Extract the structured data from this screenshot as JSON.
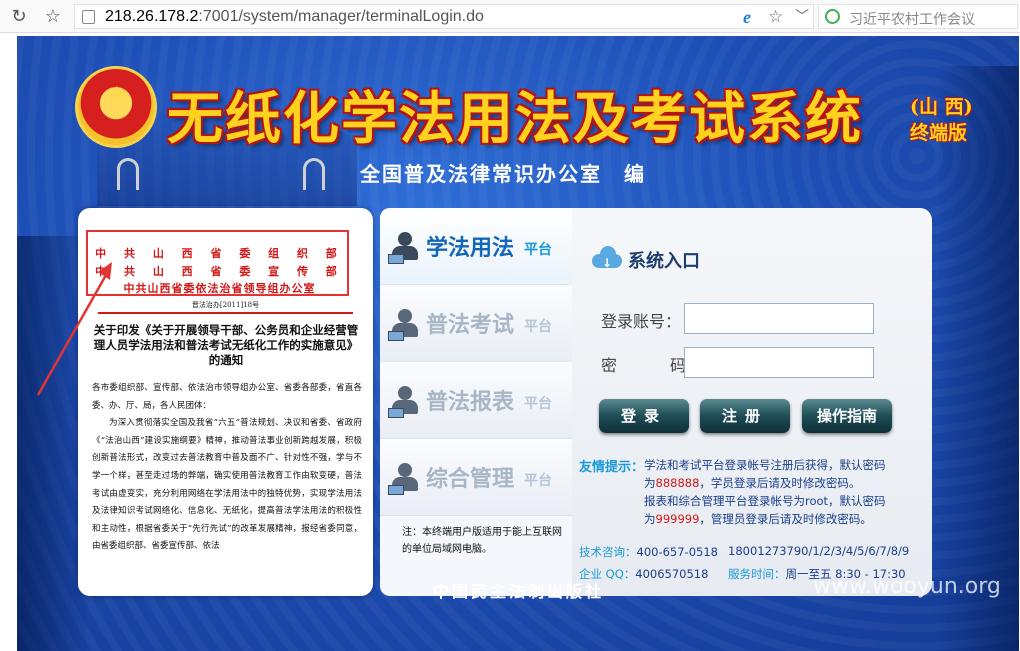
{
  "browser": {
    "url_host": "218.26.178.2",
    "url_rest": ":7001/system/manager/terminalLogin.do",
    "search_placeholder": "习近平农村工作会议"
  },
  "header": {
    "title": "无纸化学法用法及考试系统",
    "region": "(山 西)",
    "version": "终端版",
    "editor": "全国普及法律常识办公室　编"
  },
  "notice": {
    "org_1": "中 共 山 西 省 委 组 织 部",
    "org_2": "中 共 山 西 省 委 宣 传 部",
    "org_3": "中共山西省委依法治省领导组办公室",
    "doc_no": "晋法治办[2011]18号",
    "title": "关于印发《关于开展领导干部、公务员和企业经营管理人员学法用法和普法考试无纸化工作的实施意见》的通知",
    "salutation": "各市委组织部、宣传部、依法治市领导组办公室、省委各部委，省直各委、办、厅、局，各人民团体：",
    "body": "为深入贯彻落实全国及我省“六五”普法规划、决议和省委、省政府《“法治山西”建设实施纲要》精神，推动普法事业创新跨越发展，积极创新普法形式，改变过去普法教育中普及面不广、针对性不强，学与不学一个样，甚至走过场的弊端，确实使用普法教育工作由软变硬，普法考试由虚变实，充分利用网络在学法用法中的独特优势，实现学法用法及法律知识考试网络化、信息化、无纸化，提高普法学法用法的积极性和主动性，根据省委关于“先行先试”的改革发展精神，报经省委同意，由省委组织部、省委宣传部、依法"
  },
  "menu": {
    "items": [
      {
        "name": "学法用法",
        "suffix": "平台"
      },
      {
        "name": "普法考试",
        "suffix": "平台"
      },
      {
        "name": "普法报表",
        "suffix": "平台"
      },
      {
        "name": "综合管理",
        "suffix": "平台"
      }
    ],
    "note": "注：本终端用户版适用于能上互联网的单位局域网电脑。"
  },
  "login": {
    "title": "系统入口",
    "account_label": "登录账号：",
    "password_label": "密",
    "password_label_2": "码：",
    "login_button": "登录",
    "register_button": "注册",
    "guide_button": "操作指南",
    "tips_label": "友情提示：",
    "tip_1": "学法和考试平台登录帐号注册后获得，默认密码",
    "tip_2_pre": "为",
    "tip_2_red": "888888",
    "tip_2_post": "，学员登录后请及时修改密码。",
    "tip_3": "报表和综合管理平台登录帐号为root，默认密码",
    "tip_4_pre": "为",
    "tip_4_red": "999999",
    "tip_4_post": "，管理员登录后请及时修改密码。",
    "support_label": "技术咨询：",
    "support_phone": "400-657-0518",
    "support_mobiles": "18001273790/1/2/3/4/5/6/7/8/9",
    "qq_label": "企业 QQ：",
    "qq": "4006570518",
    "hours_label": "服务时间：",
    "hours": "周一至五 8:30 - 17:30"
  },
  "footer": {
    "publisher": "中国民主法制出版社",
    "watermark": "www.wooyun.org"
  }
}
